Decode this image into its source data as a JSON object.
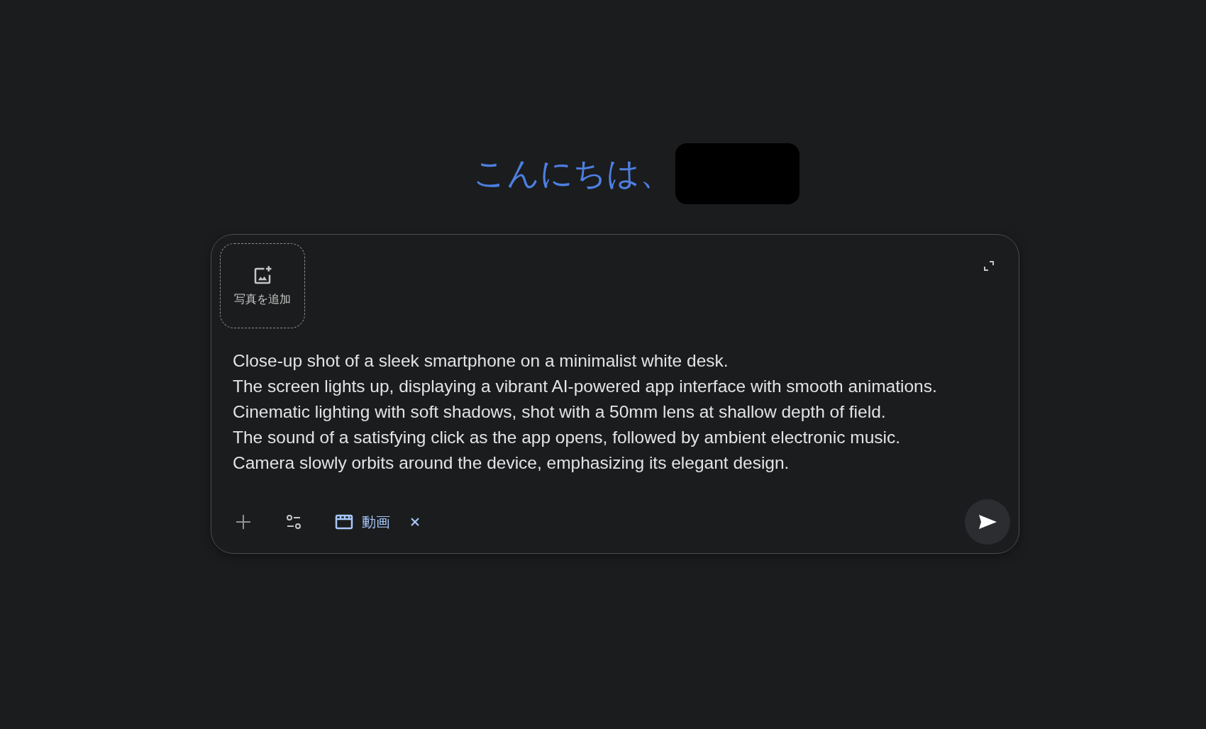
{
  "greeting": {
    "text": "こんにちは、",
    "name_redacted": true
  },
  "composer": {
    "add_photo": {
      "label": "写真を追加"
    },
    "prompt_lines": [
      "Close-up shot of a sleek smartphone on a minimalist white desk.",
      "The screen lights up, displaying a vibrant AI-powered app interface with smooth animations.",
      "Cinematic lighting with soft shadows, shot with a 50mm lens at shallow depth of field.",
      "The sound of a satisfying click as the app opens, followed by ambient electronic music.",
      "Camera slowly orbits around the device, emphasizing its elegant design."
    ],
    "mode_chip": {
      "label": "動画",
      "removable": true
    }
  }
}
